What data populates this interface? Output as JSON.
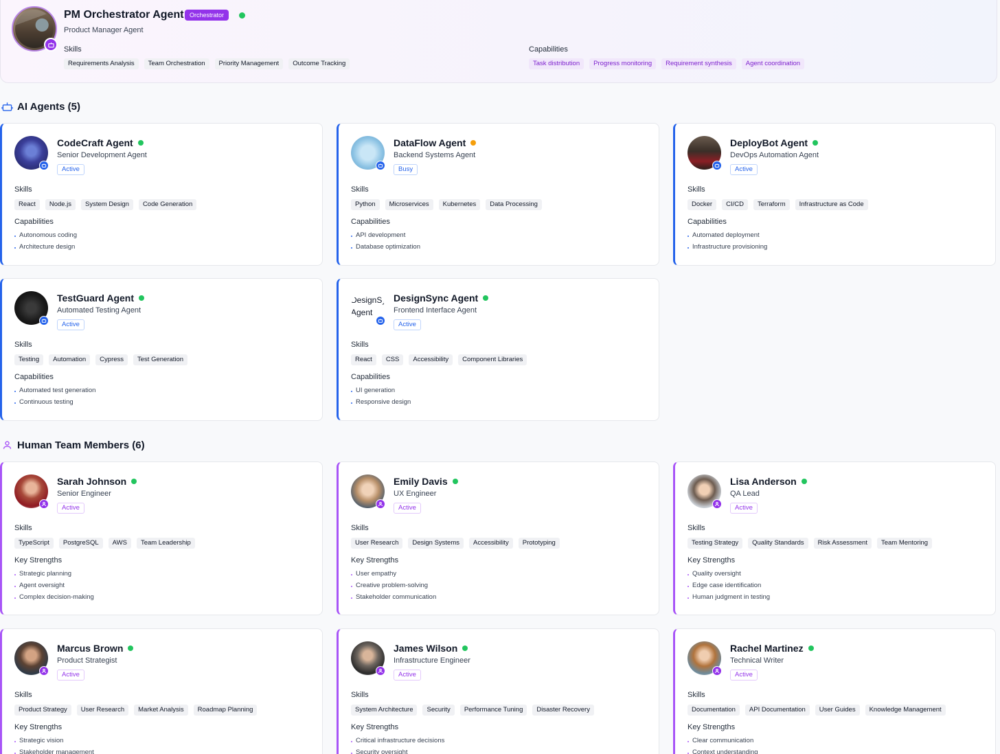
{
  "orchestrator": {
    "name": "PM Orchestrator Agent",
    "tag": "Orchestrator",
    "role": "Product Manager Agent",
    "skills_label": "Skills",
    "skills": [
      "Requirements Analysis",
      "Team Orchestration",
      "Priority Management",
      "Outcome Tracking"
    ],
    "capabilities_label": "Capabilities",
    "capabilities": [
      "Task distribution",
      "Progress monitoring",
      "Requirement synthesis",
      "Agent coordination"
    ]
  },
  "ai_section": {
    "title": "AI Agents (5)",
    "icon": "robot-icon"
  },
  "human_section": {
    "title": "Human Team Members (6)",
    "icon": "user-icon"
  },
  "labels": {
    "skills": "Skills",
    "capabilities": "Capabilities",
    "key_strengths": "Key Strengths"
  },
  "ai_agents": [
    {
      "name": "CodeCraft Agent",
      "role": "Senior Development Agent",
      "status": "Active",
      "presence": "green",
      "skills": [
        "React",
        "Node.js",
        "System Design",
        "Code Generation"
      ],
      "capabilities": [
        "Autonomous coding",
        "Architecture design"
      ]
    },
    {
      "name": "DataFlow Agent",
      "role": "Backend Systems Agent",
      "status": "Busy",
      "presence": "amber",
      "skills": [
        "Python",
        "Microservices",
        "Kubernetes",
        "Data Processing"
      ],
      "capabilities": [
        "API development",
        "Database optimization"
      ]
    },
    {
      "name": "DeployBot Agent",
      "role": "DevOps Automation Agent",
      "status": "Active",
      "presence": "green",
      "skills": [
        "Docker",
        "CI/CD",
        "Terraform",
        "Infrastructure as Code"
      ],
      "capabilities": [
        "Automated deployment",
        "Infrastructure provisioning"
      ]
    },
    {
      "name": "TestGuard Agent",
      "role": "Automated Testing Agent",
      "status": "Active",
      "presence": "green",
      "skills": [
        "Testing",
        "Automation",
        "Cypress",
        "Test Generation"
      ],
      "capabilities": [
        "Automated test generation",
        "Continuous testing"
      ]
    },
    {
      "name": "DesignSync Agent",
      "role": "Frontend Interface Agent",
      "status": "Active",
      "presence": "green",
      "avatar_alt": "DesignSync Agent",
      "skills": [
        "React",
        "CSS",
        "Accessibility",
        "Component Libraries"
      ],
      "capabilities": [
        "UI generation",
        "Responsive design"
      ]
    }
  ],
  "humans": [
    {
      "name": "Sarah Johnson",
      "role": "Senior Engineer",
      "status": "Active",
      "presence": "green",
      "skills": [
        "TypeScript",
        "PostgreSQL",
        "AWS",
        "Team Leadership"
      ],
      "strengths": [
        "Strategic planning",
        "Agent oversight",
        "Complex decision-making"
      ]
    },
    {
      "name": "Emily Davis",
      "role": "UX Engineer",
      "status": "Active",
      "presence": "green",
      "skills": [
        "User Research",
        "Design Systems",
        "Accessibility",
        "Prototyping"
      ],
      "strengths": [
        "User empathy",
        "Creative problem-solving",
        "Stakeholder communication"
      ]
    },
    {
      "name": "Lisa Anderson",
      "role": "QA Lead",
      "status": "Active",
      "presence": "green",
      "skills": [
        "Testing Strategy",
        "Quality Standards",
        "Risk Assessment",
        "Team Mentoring"
      ],
      "strengths": [
        "Quality oversight",
        "Edge case identification",
        "Human judgment in testing"
      ]
    },
    {
      "name": "Marcus Brown",
      "role": "Product Strategist",
      "status": "Active",
      "presence": "green",
      "skills": [
        "Product Strategy",
        "User Research",
        "Market Analysis",
        "Roadmap Planning"
      ],
      "strengths": [
        "Strategic vision",
        "Stakeholder management"
      ]
    },
    {
      "name": "James Wilson",
      "role": "Infrastructure Engineer",
      "status": "Active",
      "presence": "green",
      "skills": [
        "System Architecture",
        "Security",
        "Performance Tuning",
        "Disaster Recovery"
      ],
      "strengths": [
        "Critical infrastructure decisions",
        "Security oversight"
      ]
    },
    {
      "name": "Rachel Martinez",
      "role": "Technical Writer",
      "status": "Active",
      "presence": "green",
      "skills": [
        "Documentation",
        "API Documentation",
        "User Guides",
        "Knowledge Management"
      ],
      "strengths": [
        "Clear communication",
        "Context understanding"
      ]
    }
  ],
  "colors": {
    "ai_accent": "#2563eb",
    "human_accent": "#a855f7",
    "orchestrator_accent": "#9333ea",
    "online": "#22c55e",
    "busy": "#f59e0b"
  }
}
